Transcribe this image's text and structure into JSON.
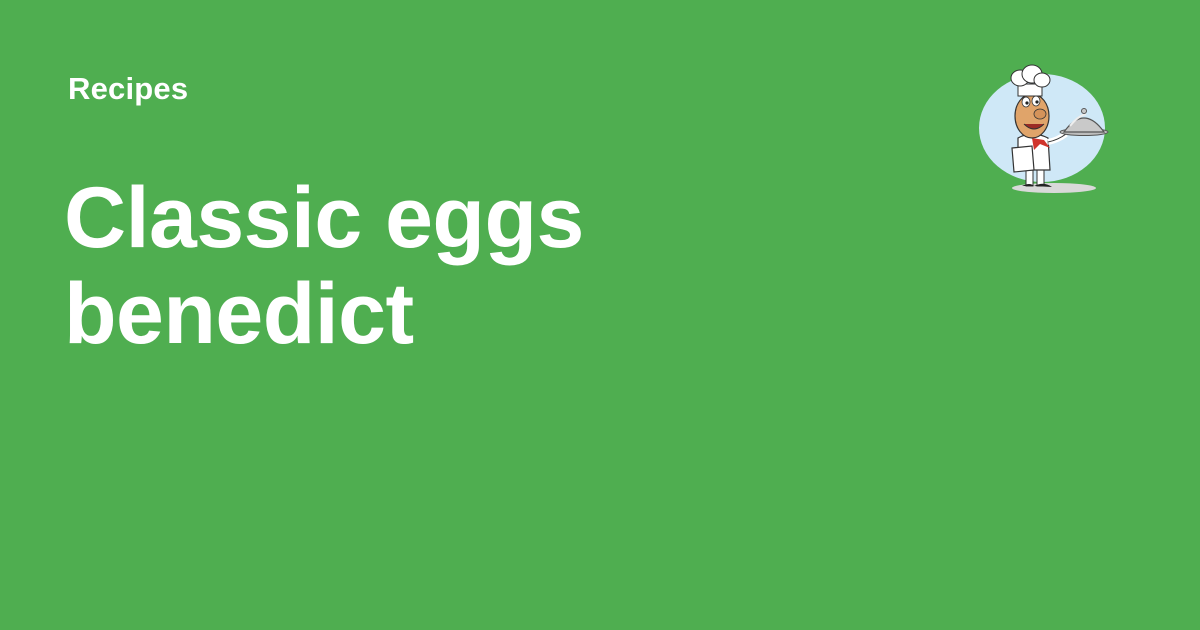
{
  "header": {
    "category": "Recipes"
  },
  "main": {
    "title": "Classic eggs benedict"
  },
  "logo": {
    "icon": "chef-with-cloche-icon"
  },
  "colors": {
    "background": "#4fae50",
    "text": "#ffffff",
    "logo_circle": "#cfe8f7"
  }
}
